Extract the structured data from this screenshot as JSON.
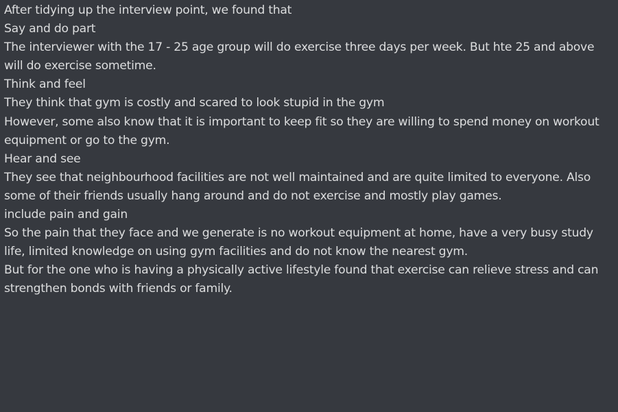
{
  "message": {
    "paragraphs": [
      "After tidying up the interview point, we found that",
      "Say and do part",
      "The interviewer with the 17 - 25 age group will do exercise three days per week. But hte 25 and above will do exercise sometime.",
      "Think and feel",
      "They think that gym is costly and scared to look stupid in the gym",
      "However, some also know that it is important to keep fit so they are willing to spend money on workout equipment or go to the gym.",
      "Hear and see",
      "They see that neighbourhood facilities are not well maintained and are quite limited to everyone. Also some of their friends usually hang around and do not exercise and mostly play games.",
      "include pain and gain",
      "So the pain that they face and we generate is no workout equipment at home, have a very busy study life, limited knowledge on using gym facilities and do not know the nearest gym.",
      "But for the one who is having a physically active lifestyle found that exercise can relieve stress and can strengthen bonds with friends or family."
    ]
  },
  "colors": {
    "background": "#36393f",
    "text": "#dcddde"
  }
}
